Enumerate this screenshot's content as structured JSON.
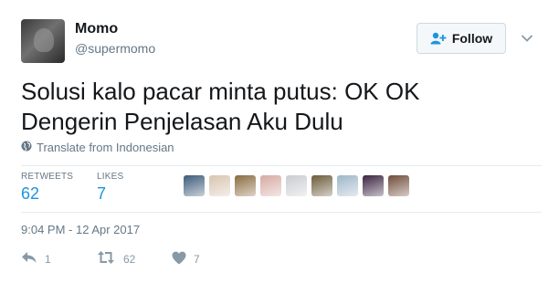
{
  "user": {
    "name": "Momo",
    "handle": "@supermomo"
  },
  "follow_label": "Follow",
  "tweet": {
    "line1": "Solusi kalo pacar minta putus: OK OK",
    "line2": "Dengerin Penjelasan Aku Dulu"
  },
  "translate_label": "Translate from Indonesian",
  "stats": {
    "retweets_label": "RETWEETS",
    "retweets_count": "62",
    "likes_label": "LIKES",
    "likes_count": "7"
  },
  "likers": [
    {
      "color": "#3c5a78"
    },
    {
      "color": "#d8c4b0"
    },
    {
      "color": "#8a6a3e"
    },
    {
      "color": "#d6a9a3"
    },
    {
      "color": "#c9ccd1"
    },
    {
      "color": "#6b5a3a"
    },
    {
      "color": "#9fb6c8"
    },
    {
      "color": "#3a2340"
    },
    {
      "color": "#6f4b3a"
    }
  ],
  "timestamp": "9:04 PM - 12 Apr 2017",
  "actions": {
    "reply_count": "1",
    "retweet_count": "62",
    "like_count": "7"
  },
  "colors": {
    "accent": "#1b95e0",
    "muted": "#657786",
    "action_gray": "#8899a6"
  }
}
